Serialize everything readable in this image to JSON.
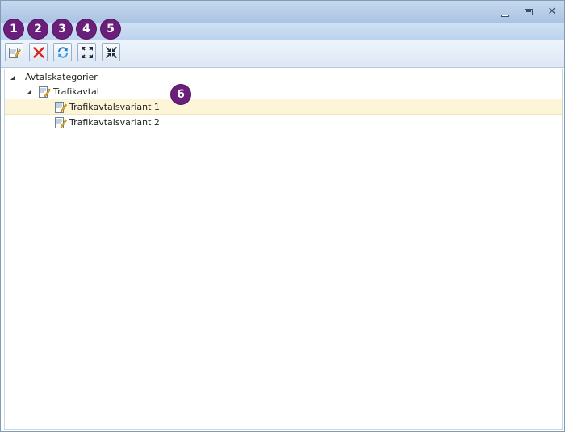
{
  "toolbar": {
    "buttons": [
      {
        "name": "new-agreement-button",
        "icon": "edit-document-icon"
      },
      {
        "name": "delete-button",
        "icon": "red-x-icon"
      },
      {
        "name": "refresh-button",
        "icon": "refresh-icon"
      },
      {
        "name": "expand-all-button",
        "icon": "expand-arrows-icon"
      },
      {
        "name": "collapse-all-button",
        "icon": "collapse-arrows-icon"
      }
    ]
  },
  "badges": [
    "1",
    "2",
    "3",
    "4",
    "5",
    "6"
  ],
  "tree": {
    "root": "Avtalskategorier",
    "category": "Trafikavtal",
    "variants": [
      "Trafikavtalsvariant 1",
      "Trafikavtalsvariant 2"
    ],
    "selected_index": 0
  },
  "colors": {
    "badge": "#6a1f7a",
    "selection": "#fdf5d8",
    "titlebar": "#a9c3e3"
  }
}
